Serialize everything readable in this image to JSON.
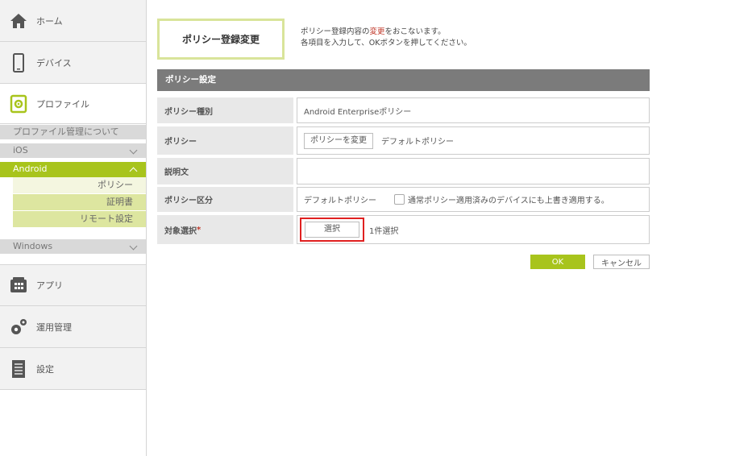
{
  "sidebar": {
    "home_label": "ホーム",
    "device_label": "デバイス",
    "profile_label": "プロファイル",
    "profile_about_label": "プロファイル管理について",
    "ios_label": "iOS",
    "android_label": "Android",
    "android_items": [
      "ポリシー",
      "証明書",
      "リモート設定"
    ],
    "windows_label": "Windows",
    "app_label": "アプリ",
    "operations_label": "運用管理",
    "settings_label": "設定"
  },
  "page": {
    "title": "ポリシー登録変更",
    "intro_line1_prefix": "ポリシー登録内容の",
    "intro_line1_highlight": "変更",
    "intro_line1_suffix": "をおこないます。",
    "intro_line2": "各項目を入力して、OKボタンを押してください。",
    "section_title": "ポリシー設定"
  },
  "form": {
    "policy_type_label": "ポリシー種別",
    "policy_type_value": "Android Enterpriseポリシー",
    "policy_label": "ポリシー",
    "change_policy_button": "ポリシーを変更",
    "policy_value": "デフォルトポリシー",
    "description_label": "説明文",
    "description_value": "",
    "policy_category_label": "ポリシー区分",
    "policy_category_value": "デフォルトポリシー",
    "apply_checkbox_label": "通常ポリシー適用済みのデバイスにも上書き適用する。",
    "target_label": "対象選択",
    "target_required_mark": "*",
    "select_button": "選択",
    "target_count": "1件選択"
  },
  "buttons": {
    "ok": "OK",
    "cancel": "キャンセル"
  },
  "colors": {
    "accent": "#a8c41c",
    "highlight_red": "#c0392b",
    "section_bar": "#7b7b7b"
  }
}
